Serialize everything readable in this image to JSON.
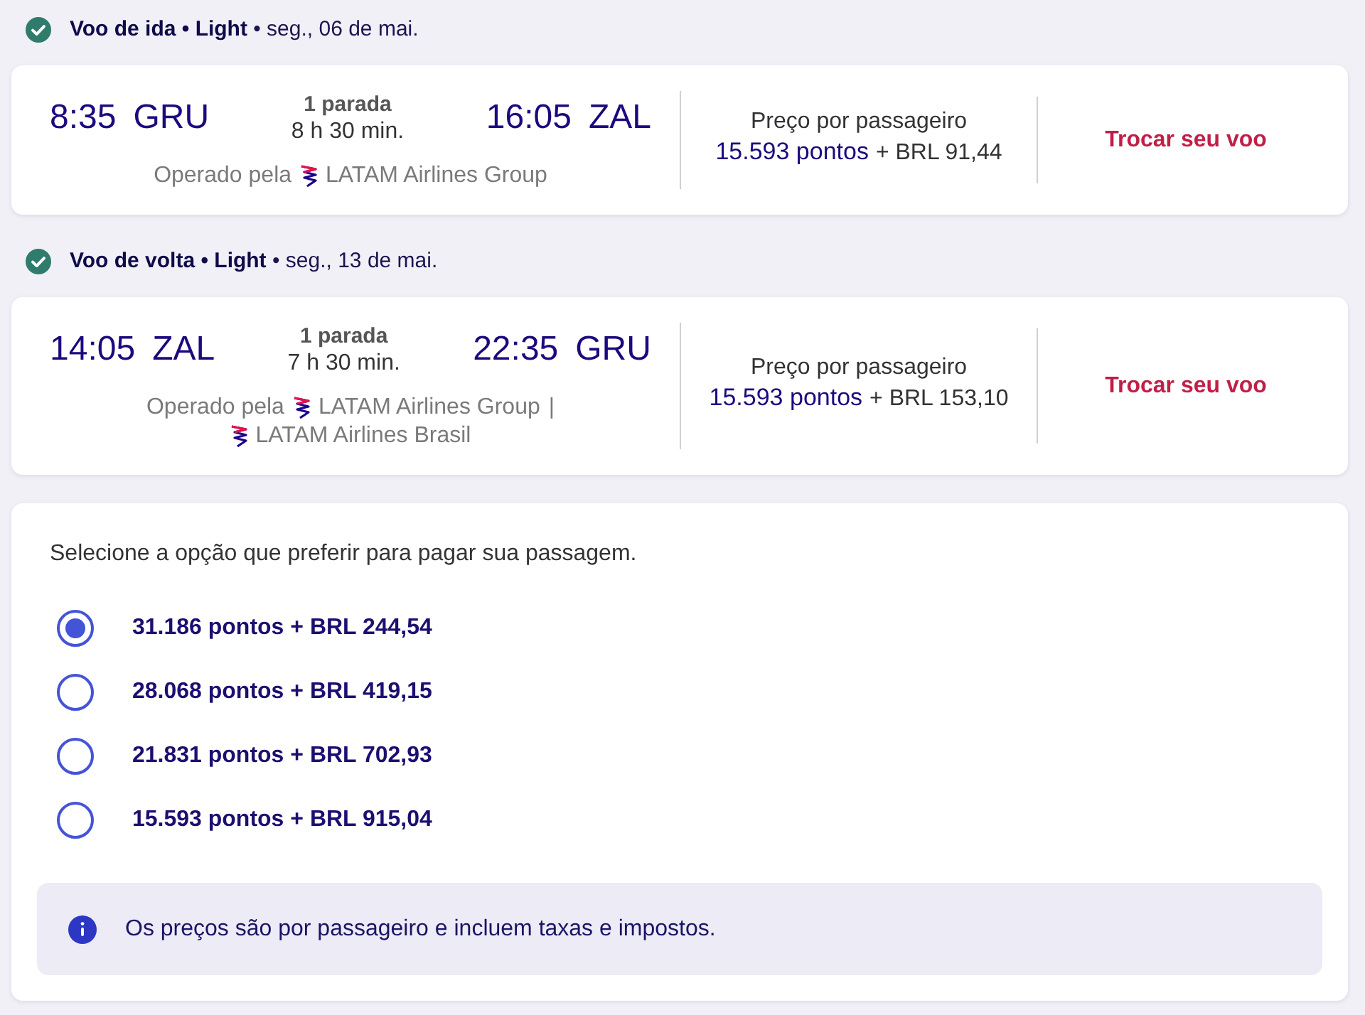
{
  "flights": [
    {
      "done": true,
      "title": "**Voo de ida • Light** • seg., 06 de mai.",
      "departure": {
        "time": "8:35",
        "airport": "GRU"
      },
      "stops": "1 parada",
      "duration": "8 h 30 min.",
      "arrival": {
        "time": "16:05",
        "airport": "ZAL"
      },
      "operated_label": "Operado pela",
      "operators": [
        "LATAM Airlines Group"
      ],
      "price_label": "Preço por passageiro",
      "price_points": "15.593 pontos",
      "price_cash": "+ BRL 91,44",
      "change_link": "Trocar seu voo"
    },
    {
      "done": true,
      "title": "**Voo de volta • Light** • seg., 13 de mai.",
      "departure": {
        "time": "14:05",
        "airport": "ZAL"
      },
      "stops": "1 parada",
      "duration": "7 h 30 min.",
      "arrival": {
        "time": "22:35",
        "airport": "GRU"
      },
      "operated_label": "Operado pela",
      "operators": [
        "LATAM Airlines Group",
        "LATAM Airlines Brasil"
      ],
      "operator_separator": "|",
      "price_label": "Preço por passageiro",
      "price_points": "15.593 pontos",
      "price_cash": "+ BRL 153,10",
      "change_link": "Trocar seu voo"
    }
  ],
  "payment": {
    "prompt": "Selecione a opção que preferir para pagar sua passagem.",
    "options": [
      {
        "label": "31.186 pontos + BRL 244,54",
        "selected": true
      },
      {
        "label": "28.068 pontos + BRL 419,15",
        "selected": false
      },
      {
        "label": "21.831 pontos + BRL 702,93",
        "selected": false
      },
      {
        "label": "15.593 pontos + BRL 915,04",
        "selected": false
      }
    ],
    "notice": "Os preços são por passageiro e incluem taxas e impostos."
  }
}
